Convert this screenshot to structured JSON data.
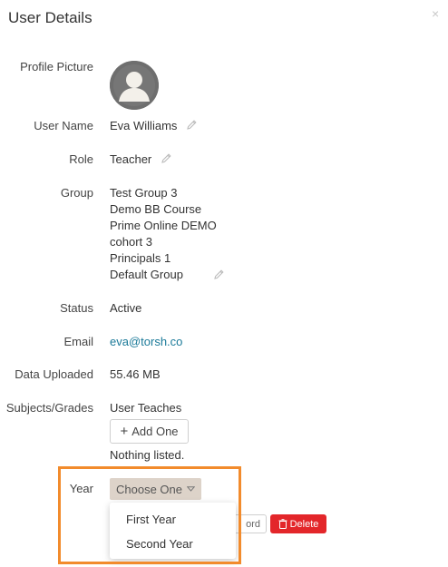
{
  "modal": {
    "title": "User Details",
    "close_glyph": "×"
  },
  "fields": {
    "profile_picture_label": "Profile Picture",
    "user_name_label": "User Name",
    "user_name_value": "Eva Williams",
    "role_label": "Role",
    "role_value": "Teacher",
    "group_label": "Group",
    "groups": [
      "Test Group 3",
      "Demo BB Course",
      "Prime Online DEMO",
      "cohort 3",
      "Principals 1",
      "Default Group"
    ],
    "status_label": "Status",
    "status_value": "Active",
    "email_label": "Email",
    "email_value": "eva@torsh.co",
    "data_uploaded_label": "Data Uploaded",
    "data_uploaded_value": "55.46 MB",
    "subjects_label": "Subjects/Grades",
    "subjects_value": "User Teaches",
    "add_one_label": "Add One",
    "nothing_listed": "Nothing listed.",
    "year_label": "Year",
    "year_select_value": "Choose One",
    "year_options": [
      "First Year",
      "Second Year"
    ]
  },
  "actions": {
    "reset_partial_label": "ord",
    "delete_label": "Delete"
  },
  "icons": {
    "close": "close-icon",
    "edit": "pencil-icon",
    "avatar": "avatar-icon",
    "caret": "caret-down-icon",
    "trash": "trash-icon"
  },
  "colors": {
    "email_link": "#1b7a99",
    "select_bg": "#ddd3c9",
    "delete_bg": "#e3262a",
    "highlight": "#f28b2c"
  }
}
